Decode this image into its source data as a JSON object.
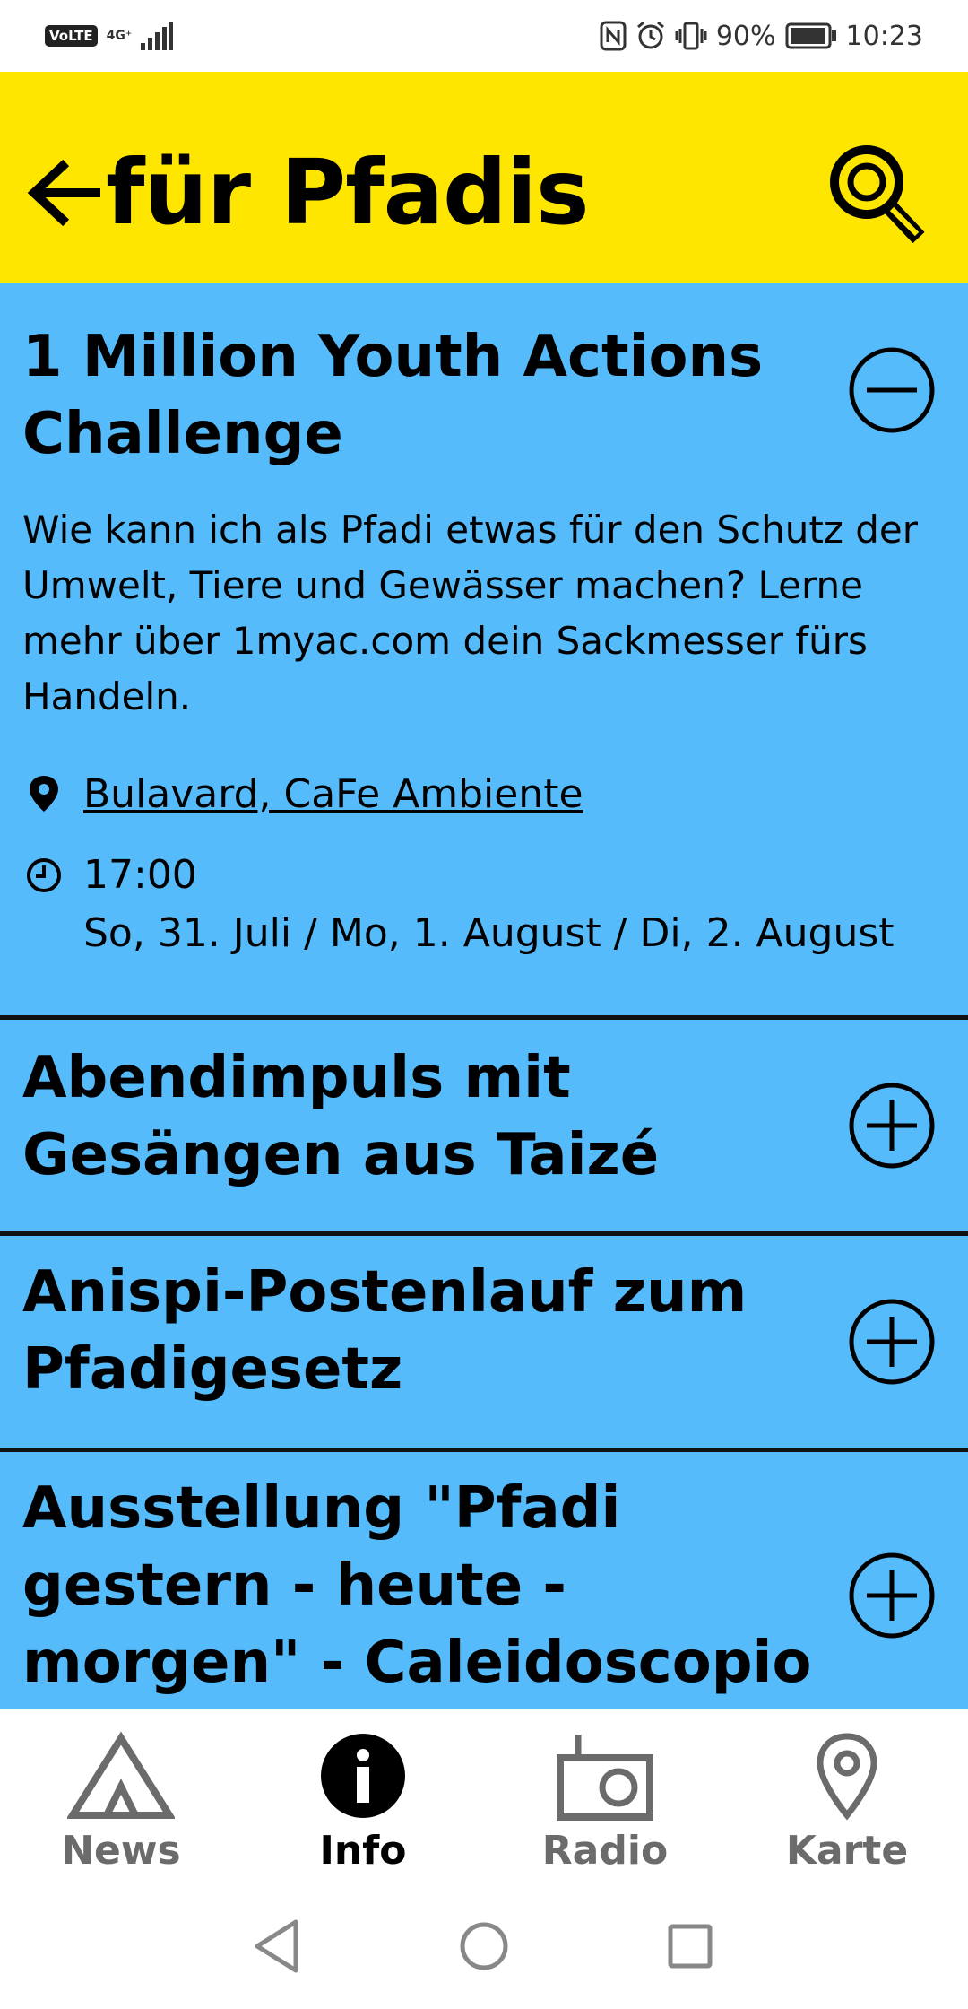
{
  "status_bar": {
    "volte": "VoLTE",
    "network": "4G⁺",
    "battery": "90%",
    "time": "10:23"
  },
  "header": {
    "title": "für Pfadis",
    "background": "#FFE600"
  },
  "list_background": "#55BBFB",
  "items": [
    {
      "title": "1 Million Youth Actions Challenge",
      "expanded": true,
      "description": "Wie kann ich als Pfadi etwas für den Schutz der Umwelt, Tiere und Gewässer machen? Lerne mehr über 1myac.com dein Sackmesser fürs Handeln.",
      "location": "Bulavard, CaFe Ambiente",
      "time": "17:00",
      "dates": "So, 31. Juli / Mo, 1. August / Di, 2. August"
    },
    {
      "title": "Abendimpuls mit Gesängen aus Taizé",
      "expanded": false
    },
    {
      "title": "Anispi-Postenlauf zum Pfadigesetz",
      "expanded": false
    },
    {
      "title": "Ausstellung \"Pfadi gestern - heute - morgen\" - Caleidoscopio",
      "expanded": false
    }
  ],
  "bottom_nav": {
    "news": "News",
    "info": "Info",
    "radio": "Radio",
    "karte": "Karte",
    "active": "Info"
  }
}
